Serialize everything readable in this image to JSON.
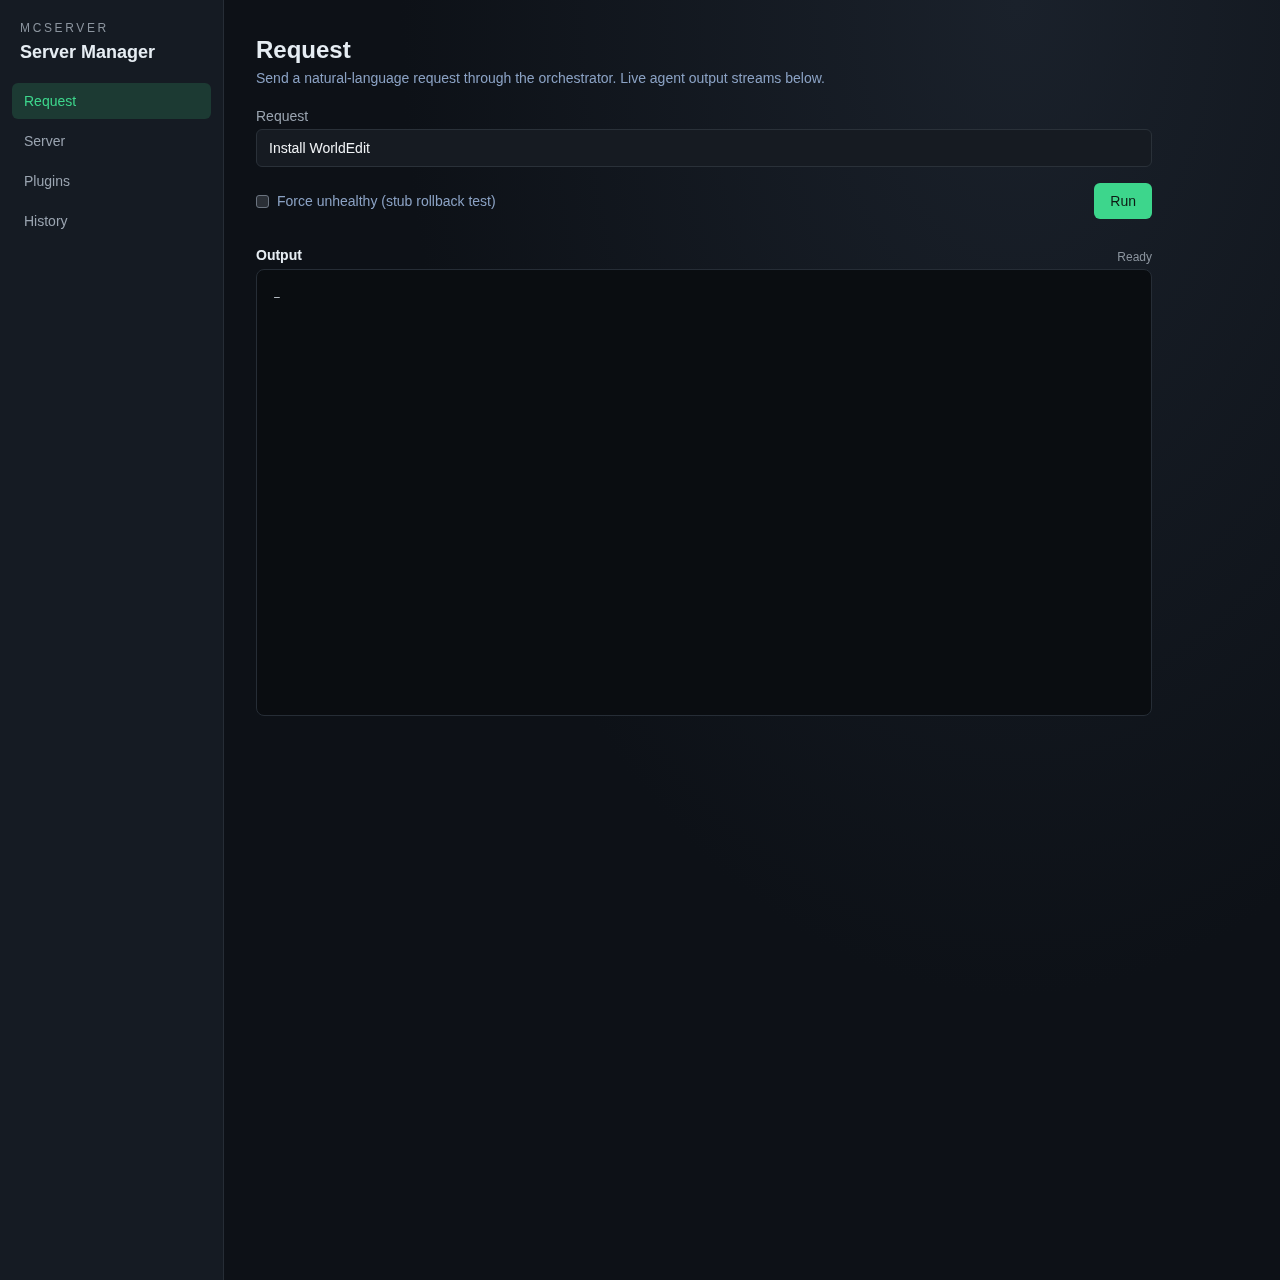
{
  "sidebar": {
    "eyebrow": "MCSERVER",
    "title": "Server Manager",
    "items": [
      {
        "label": "Request",
        "selected": true
      },
      {
        "label": "Server",
        "selected": false
      },
      {
        "label": "Plugins",
        "selected": false
      },
      {
        "label": "History",
        "selected": false
      }
    ]
  },
  "page": {
    "title": "Request",
    "subtitle": "Send a natural-language request through the orchestrator. Live agent output streams below."
  },
  "request_field": {
    "label": "Request",
    "value": "Install WorldEdit"
  },
  "force_unhealthy": {
    "label": "Force unhealthy (stub rollback test)",
    "checked": false
  },
  "run_button": {
    "label": "Run"
  },
  "output": {
    "label": "Output",
    "status": "Ready",
    "text": "–"
  }
}
